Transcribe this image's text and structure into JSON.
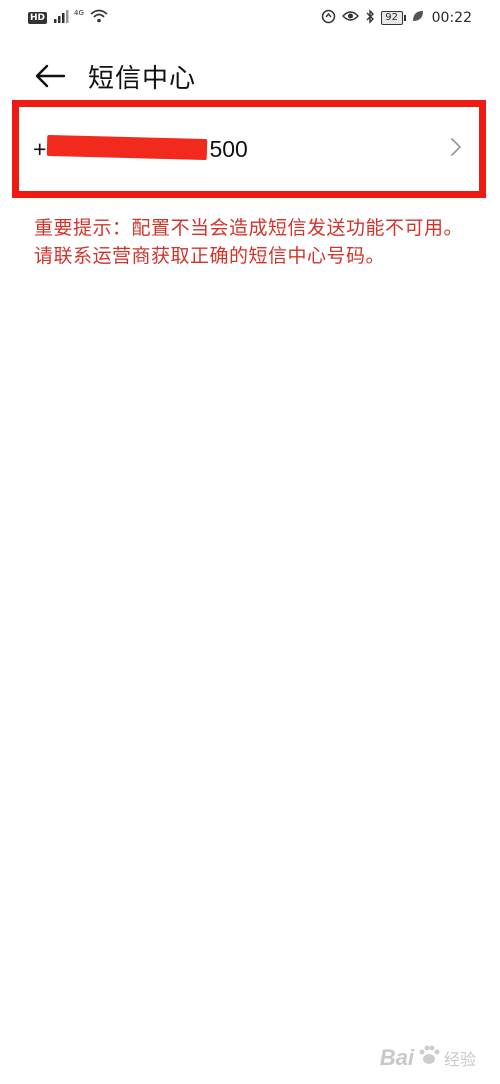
{
  "status_bar": {
    "hd": "HD",
    "network": "4G",
    "battery": "92",
    "time": "00:22"
  },
  "header": {
    "back_icon": "arrow-left-icon",
    "title": "短信中心"
  },
  "sms_center": {
    "number_prefix": "+",
    "number_suffix": "500",
    "chevron_icon": "chevron-right-icon",
    "highlight_color": "#ee1b12"
  },
  "warning": {
    "text": "重要提示：配置不当会造成短信发送功能不可用。请联系运营商获取正确的短信中心号码。",
    "color": "#d2342c"
  },
  "watermark": {
    "brand": "Bai",
    "sub": "经验"
  }
}
